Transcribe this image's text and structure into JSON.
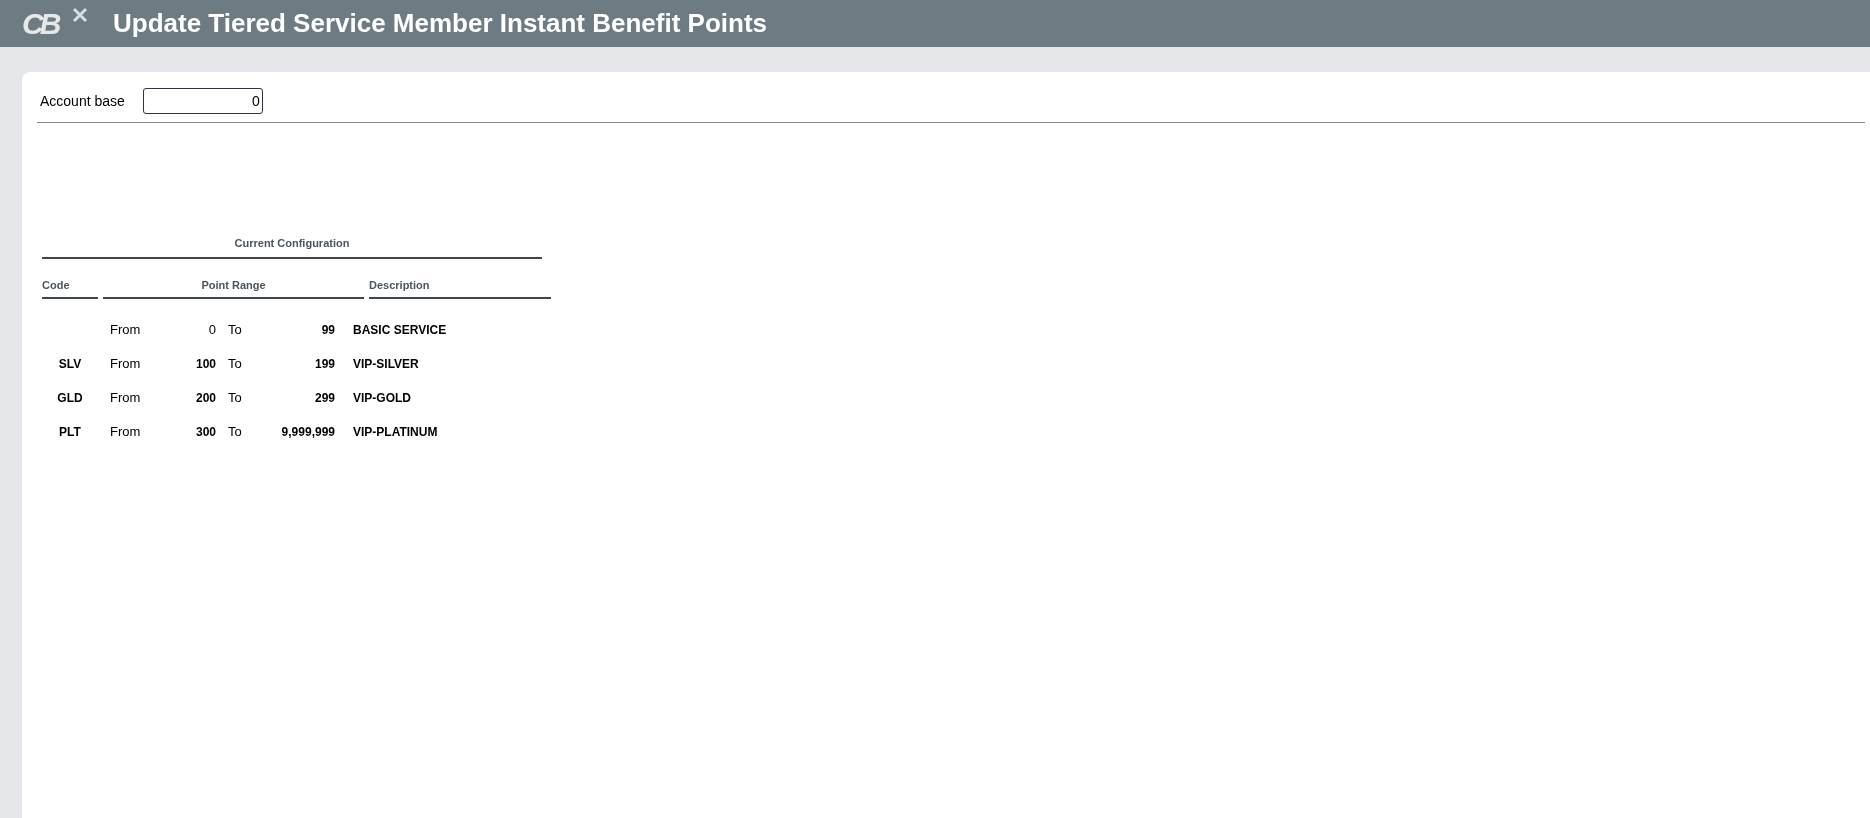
{
  "header": {
    "logo": "CB",
    "title": "Update Tiered Service Member Instant Benefit Points"
  },
  "account_base": {
    "label": "Account base",
    "value": "0"
  },
  "configuration": {
    "title": "Current Configuration",
    "columns": [
      "Code",
      "Point Range",
      "Description"
    ],
    "rows": [
      {
        "code": "",
        "from_label": "From",
        "from": "0",
        "from_bold": false,
        "to_label": "To",
        "to": "99",
        "description": "BASIC SERVICE"
      },
      {
        "code": "SLV",
        "from_label": "From",
        "from": "100",
        "from_bold": true,
        "to_label": "To",
        "to": "199",
        "description": "VIP-SILVER"
      },
      {
        "code": "GLD",
        "from_label": "From",
        "from": "200",
        "from_bold": true,
        "to_label": "To",
        "to": "299",
        "description": "VIP-GOLD"
      },
      {
        "code": "PLT",
        "from_label": "From",
        "from": "300",
        "from_bold": true,
        "to_label": "To",
        "to": "9,999,999",
        "description": "VIP-PLATINUM"
      }
    ]
  }
}
